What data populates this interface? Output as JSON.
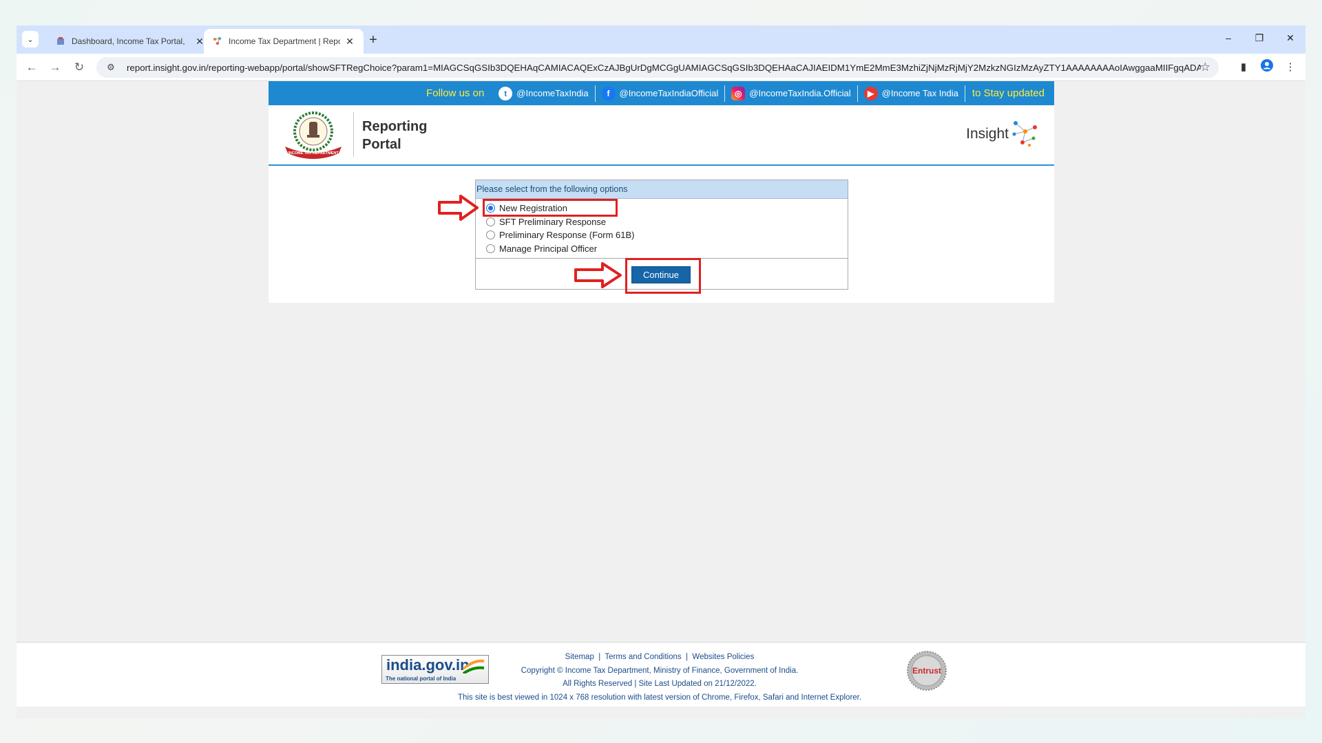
{
  "browser": {
    "tabs": [
      {
        "title": "Dashboard, Income Tax Portal, ",
        "active": false
      },
      {
        "title": "Income Tax Department | Repor",
        "active": true
      }
    ],
    "url": "report.insight.gov.in/reporting-webapp/portal/showSFTRegChoice?param1=MIAGCSqGSIb3DQEHAqCAMIACAQExCzAJBgUrDgMCGgUAMIAGCSqGSIb3DQEHAaCAJIAEIDM1YmE2MmE3MzhiZjNjMzRjMjY2MzkzNGIzMzAyZTY1AAAAAAAAoIAwggaaMIIFgqADA..."
  },
  "site": {
    "follow_label": "Follow us on",
    "socials": [
      {
        "handle": "@IncomeTaxIndia",
        "icon": "twitter-icon"
      },
      {
        "handle": "@IncomeTaxIndiaOfficial",
        "icon": "facebook-icon"
      },
      {
        "handle": "@IncomeTaxIndia.Official",
        "icon": "instagram-icon"
      },
      {
        "handle": "@Income Tax India",
        "icon": "youtube-icon"
      }
    ],
    "stay_label": "to Stay updated",
    "brand_line1": "Reporting",
    "brand_line2": "Portal",
    "insight_label": "Insight",
    "emblem_text": "INCOME TAX DEPARTMENT"
  },
  "form": {
    "heading": "Please select from the following options",
    "options": [
      {
        "label": "New Registration",
        "checked": true
      },
      {
        "label": "SFT Preliminary Response",
        "checked": false
      },
      {
        "label": "Preliminary Response (Form 61B)",
        "checked": false
      },
      {
        "label": "Manage Principal Officer",
        "checked": false
      }
    ],
    "continue_label": "Continue"
  },
  "footer": {
    "links": [
      "Sitemap",
      "Terms and Conditions",
      "Websites Policies"
    ],
    "copyright": "Copyright © Income Tax Department, Ministry of Finance, Government of India.",
    "rights": "All Rights Reserved | Site Last Updated on 21/12/2022.",
    "best_viewed": "This site is best viewed in 1024 x 768 resolution with latest version of Chrome, Firefox, Safari and Internet Explorer.",
    "indiagov_big": "india.gov.in",
    "indiagov_small": "The national portal of India",
    "entrust_label": "Entrust"
  },
  "colors": {
    "follow_bar": "#1e88d0",
    "highlight": "#e02020",
    "button": "#1565a8"
  }
}
